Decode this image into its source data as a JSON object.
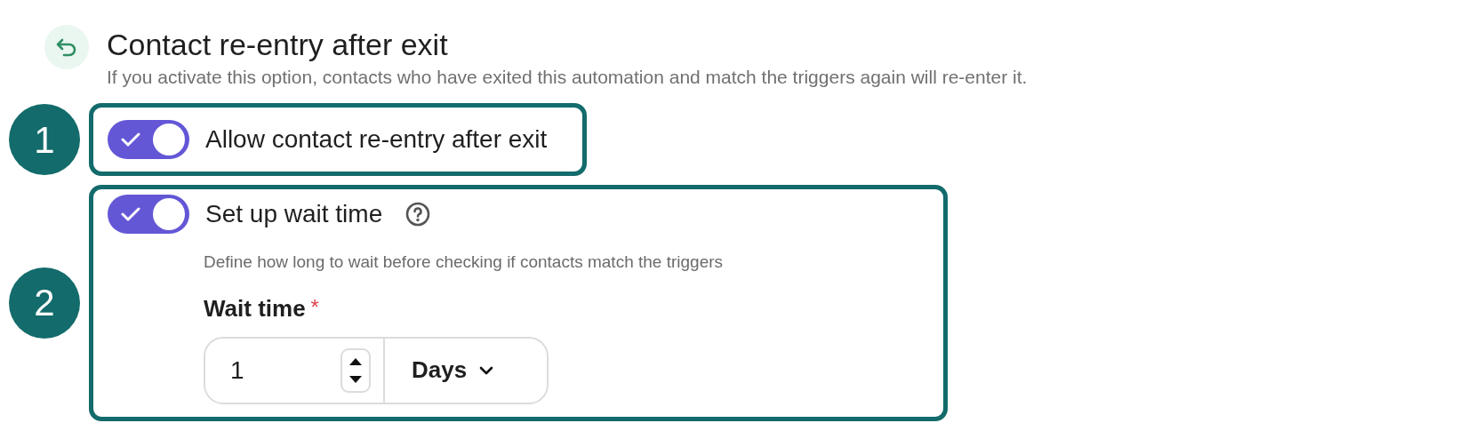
{
  "header": {
    "title": "Contact re-entry after exit",
    "description": "If you activate this option, contacts who have exited this automation and match the triggers again will re-enter it."
  },
  "sections": [
    {
      "badge": "1",
      "toggle": {
        "label": "Allow contact re-entry after exit",
        "on": true
      }
    },
    {
      "badge": "2",
      "toggle": {
        "label": "Set up wait time",
        "on": true
      },
      "hint": "Define how long to wait before checking if contacts match the triggers",
      "field": {
        "label": "Wait time",
        "required_mark": "*",
        "value": "1",
        "unit": "Days"
      }
    }
  ]
}
